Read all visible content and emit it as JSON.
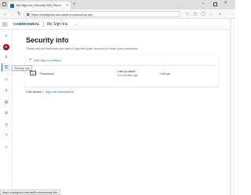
{
  "browser": {
    "tab_title": "My Sign-Ins | Security Info | Micro",
    "new_tab_symbol": "+",
    "close_symbol": "×",
    "url": "https://mysignins.microsoft.com/security-info"
  },
  "app_header": {
    "brand": "COMMONWEAL",
    "app_name": "My Sign-Ins",
    "chevron": "⌄"
  },
  "rail": {
    "avatar_initial": "R",
    "tooltip": "Security info"
  },
  "main": {
    "title": "Security info",
    "subtitle": "These are the methods you use to sign into your account or reset your password.",
    "add_method": "Add sign-in method",
    "methods": [
      {
        "name": "Password",
        "last_updated_label": "Last updated:",
        "last_updated_value": "14 minutes ago",
        "action": "Change"
      }
    ],
    "lost_device_question": "Lost device?",
    "lost_device_link": "Sign out everywhere"
  },
  "status_bar": {
    "url": "https://mysignins.microsoft.com/security-info"
  },
  "colors": {
    "accent": "#0f6cbd",
    "avatar": "#b1101a",
    "brand": "#1c3f6e"
  }
}
